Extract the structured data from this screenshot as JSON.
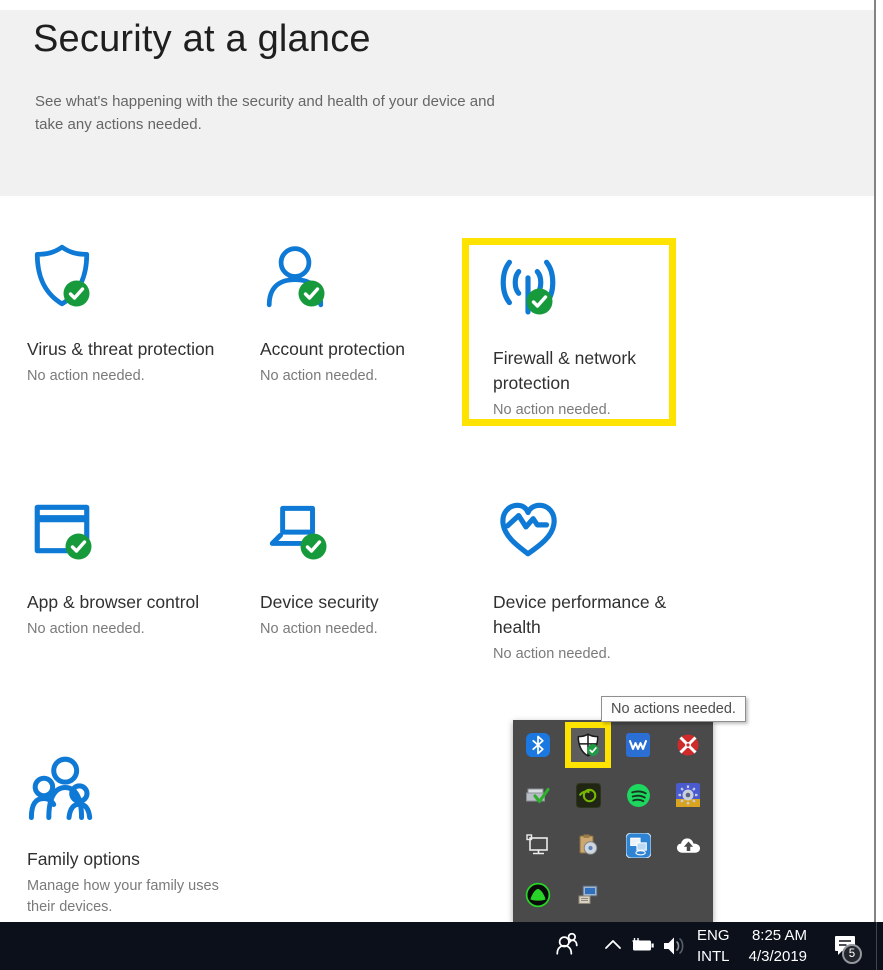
{
  "header": {
    "title": "Security at a glance",
    "subtitle": "See what's happening with the security and health of your device and take any actions needed."
  },
  "tiles": {
    "virus": {
      "title": "Virus & threat protection",
      "status": "No action needed."
    },
    "account": {
      "title": "Account protection",
      "status": "No action needed."
    },
    "firewall": {
      "title": "Firewall & network protection",
      "status": "No action needed.",
      "highlighted": true
    },
    "app": {
      "title": "App & browser control",
      "status": "No action needed."
    },
    "device": {
      "title": "Device security",
      "status": "No action needed."
    },
    "health": {
      "title": "Device performance & health",
      "status": "No action needed."
    },
    "family": {
      "title": "Family options",
      "status": "Manage how your family uses their devices."
    }
  },
  "tooltip": {
    "text": "No actions needed."
  },
  "tray": {
    "icons": [
      "bluetooth",
      "windows-defender",
      "waves-audio",
      "pinwheel-ball",
      "device-check",
      "nvidia-settings",
      "spotify",
      "gear-utility",
      "ethernet-status",
      "media-writer",
      "intel-graphics",
      "onedrive",
      "network-ball",
      "removable-storage"
    ],
    "highlighted_icon": "windows-defender"
  },
  "taskbar": {
    "language": {
      "line1": "ENG",
      "line2": "INTL"
    },
    "clock": {
      "time": "8:25 AM",
      "date": "4/3/2019"
    },
    "notification_count": "5"
  },
  "colors": {
    "accent_blue": "#0f7ad5",
    "status_green": "#179a3c",
    "highlight_yellow": "#ffe300",
    "tray_background": "#4a4a4a",
    "taskbar_background": "#0b101b"
  }
}
